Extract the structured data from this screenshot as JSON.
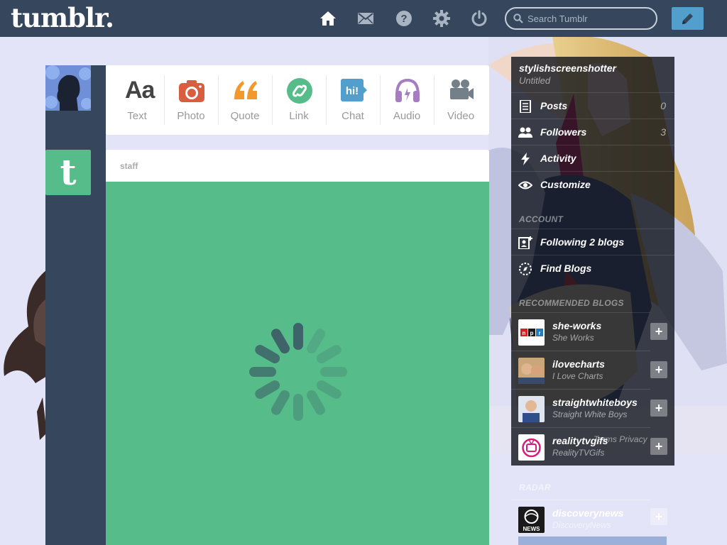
{
  "header": {
    "logo": "tumblr.",
    "search_placeholder": "Search Tumblr",
    "nav_icons": [
      "home-icon",
      "mail-icon",
      "help-icon",
      "gear-icon",
      "power-icon"
    ],
    "compose_icon": "pencil-icon"
  },
  "post_types": [
    {
      "label": "Text",
      "icon": "text-icon",
      "color": "#444444"
    },
    {
      "label": "Photo",
      "icon": "camera-icon",
      "color": "#d95e40"
    },
    {
      "label": "Quote",
      "icon": "quote-icon",
      "color": "#f2992e"
    },
    {
      "label": "Link",
      "icon": "link-icon",
      "color": "#56bc8a"
    },
    {
      "label": "Chat",
      "icon": "chat-icon",
      "color": "#529ecc"
    },
    {
      "label": "Audio",
      "icon": "headphones-icon",
      "color": "#a77dc2"
    },
    {
      "label": "Video",
      "icon": "video-camera-icon",
      "color": "#748089"
    }
  ],
  "chat_icon_text": "hi!",
  "staff_avatar_letter": "t",
  "post": {
    "author": "staff",
    "status": "loading-spinner"
  },
  "sidebar": {
    "blog_name": "stylishscreenshotter",
    "blog_title": "Untitled",
    "items": [
      {
        "label": "Posts",
        "count": "0",
        "icon": "document-icon"
      },
      {
        "label": "Followers",
        "count": "3",
        "icon": "people-icon"
      },
      {
        "label": "Activity",
        "count": "",
        "icon": "lightning-icon"
      },
      {
        "label": "Customize",
        "count": "",
        "icon": "eye-icon"
      }
    ],
    "account_heading": "ACCOUNT",
    "account_items": [
      {
        "label": "Following 2 blogs",
        "icon": "add-contact-icon"
      },
      {
        "label": "Find Blogs",
        "icon": "compass-icon"
      }
    ],
    "recommended_heading": "RECOMMENDED BLOGS",
    "recommended": [
      {
        "name": "she-works",
        "subtitle": "She Works",
        "thumb": "npr-logo"
      },
      {
        "name": "ilovecharts",
        "subtitle": "I Love Charts",
        "thumb": "people-photo"
      },
      {
        "name": "straightwhiteboys",
        "subtitle": "Straight White Boys",
        "thumb": "person-photo"
      },
      {
        "name": "realitytvgifs",
        "subtitle": "RealityTVGifs",
        "thumb": "tv-logo"
      }
    ],
    "overlap_text": "Terms Privacy",
    "radar_heading": "RADAR",
    "radar": {
      "name": "discoverynews",
      "subtitle": "DiscoveryNews",
      "thumb_text": "NEWS"
    }
  }
}
